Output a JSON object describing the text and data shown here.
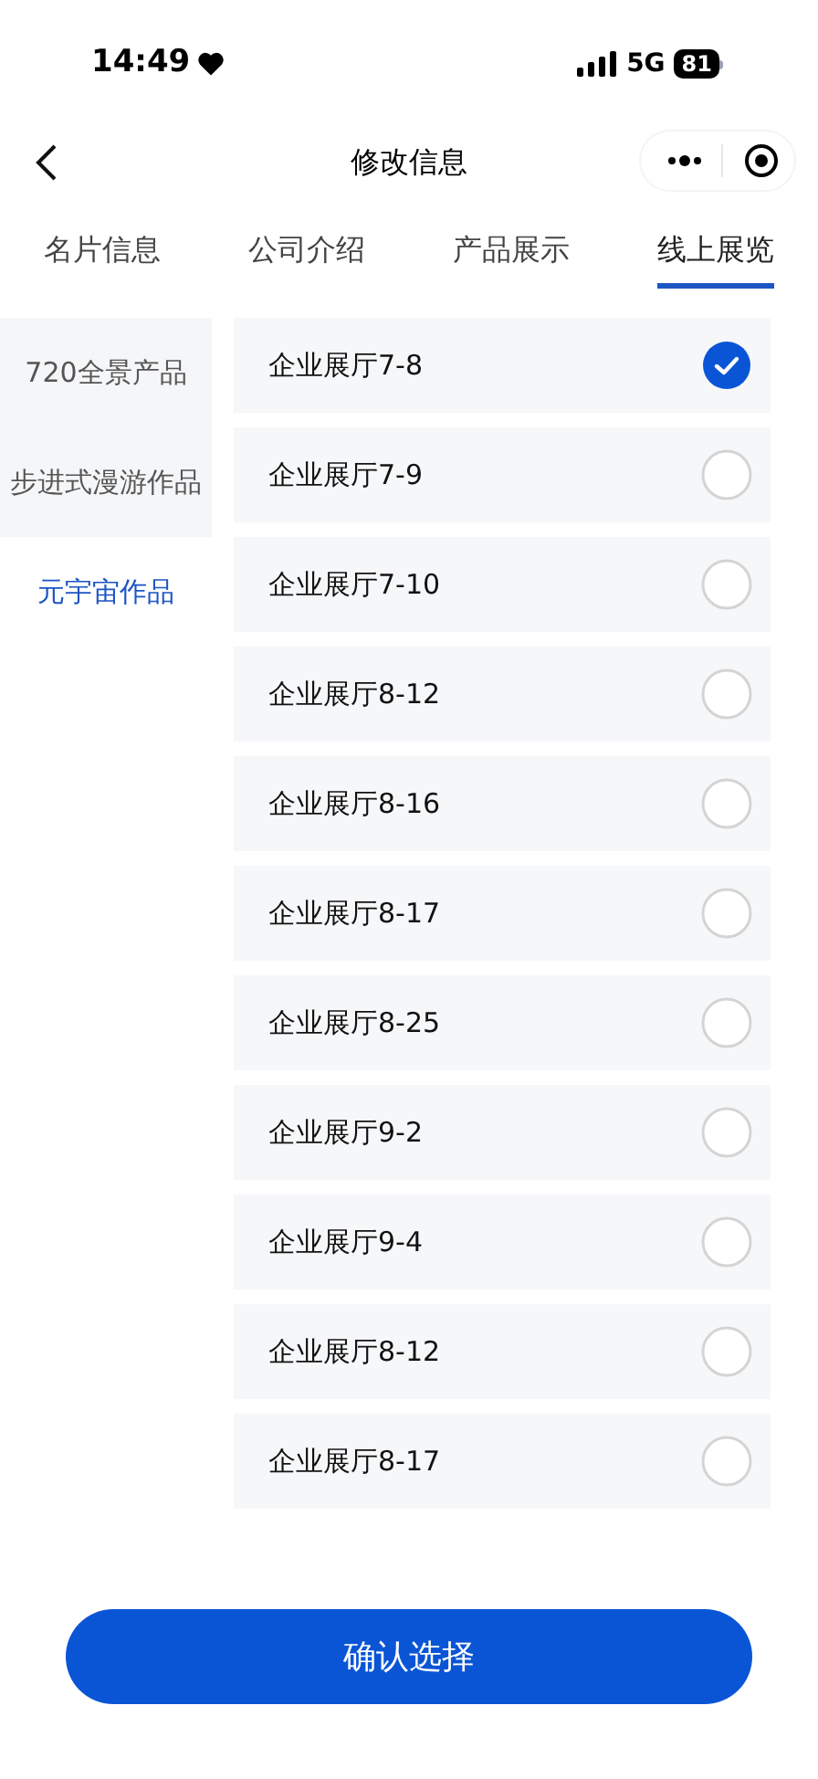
{
  "status_bar": {
    "time": "14:49",
    "network": "5G",
    "battery": "81"
  },
  "nav_bar": {
    "title": "修改信息"
  },
  "tabs": [
    {
      "label": "名片信息",
      "selected": false
    },
    {
      "label": "公司介绍",
      "selected": false
    },
    {
      "label": "产品展示",
      "selected": false
    },
    {
      "label": "线上展览",
      "selected": true
    }
  ],
  "sidebar": {
    "items": [
      {
        "label": "720全景产品",
        "selected": false
      },
      {
        "label": "步进式漫游作品",
        "selected": false
      },
      {
        "label": "元宇宙作品",
        "selected": true
      }
    ]
  },
  "list": {
    "items": [
      {
        "label": "企业展厅7-8",
        "checked": true
      },
      {
        "label": "企业展厅7-9",
        "checked": false
      },
      {
        "label": "企业展厅7-10",
        "checked": false
      },
      {
        "label": "企业展厅8-12",
        "checked": false
      },
      {
        "label": "企业展厅8-16",
        "checked": false
      },
      {
        "label": "企业展厅8-17",
        "checked": false
      },
      {
        "label": "企业展厅8-25",
        "checked": false
      },
      {
        "label": "企业展厅9-2",
        "checked": false
      },
      {
        "label": "企业展厅9-4",
        "checked": false
      },
      {
        "label": "企业展厅8-12",
        "checked": false
      },
      {
        "label": "企业展厅8-17",
        "checked": false
      }
    ]
  },
  "confirm_button": {
    "label": "确认选择"
  }
}
